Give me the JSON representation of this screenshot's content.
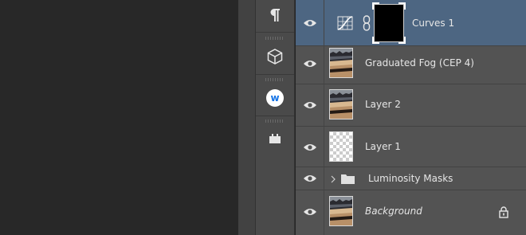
{
  "dock": {
    "buttons": [
      {
        "id": "paragraph",
        "icon": "paragraph-icon"
      },
      {
        "id": "3d",
        "icon": "cube-icon"
      },
      {
        "id": "extension",
        "icon": "w-logo-icon",
        "glyph": "w"
      },
      {
        "id": "plugin",
        "icon": "plugin-icon"
      }
    ]
  },
  "layers": [
    {
      "name": "Curves 1",
      "type": "adjustment",
      "selected": true,
      "visible": true
    },
    {
      "name": "Graduated Fog (CEP 4)",
      "type": "image",
      "selected": false,
      "visible": true
    },
    {
      "name": "Layer 2",
      "type": "image",
      "selected": false,
      "visible": true
    },
    {
      "name": "Layer 1",
      "type": "empty",
      "selected": false,
      "visible": true
    },
    {
      "name": "Luminosity Masks",
      "type": "group",
      "selected": false,
      "visible": true,
      "collapsed": true
    },
    {
      "name": "Background",
      "type": "background",
      "selected": false,
      "visible": true,
      "locked": true
    }
  ],
  "colors": {
    "selected_row": "#4d6682",
    "panel_bg": "#535353",
    "w_logo": "#1473e6"
  }
}
